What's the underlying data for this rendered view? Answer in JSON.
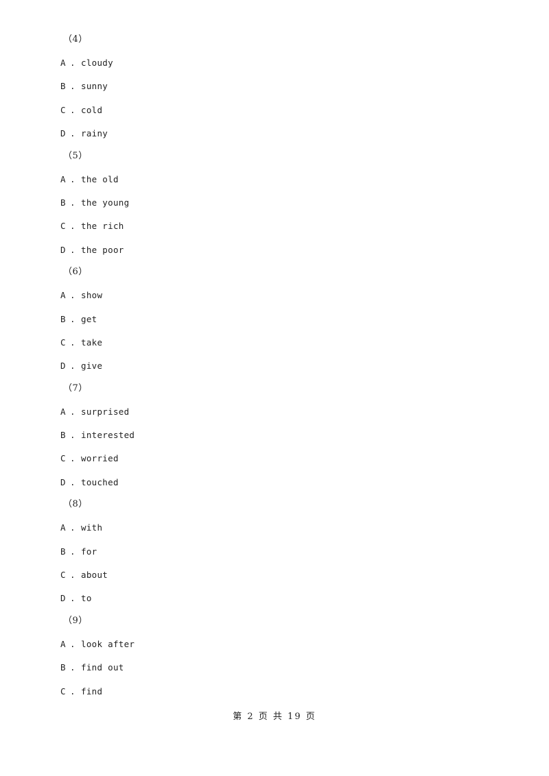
{
  "questions": [
    {
      "number": "（4）",
      "options": [
        {
          "letter": "A",
          "text": "cloudy"
        },
        {
          "letter": "B",
          "text": "sunny"
        },
        {
          "letter": "C",
          "text": "cold"
        },
        {
          "letter": "D",
          "text": "rainy"
        }
      ]
    },
    {
      "number": "（5）",
      "options": [
        {
          "letter": "A",
          "text": "the old"
        },
        {
          "letter": "B",
          "text": "the young"
        },
        {
          "letter": "C",
          "text": "the rich"
        },
        {
          "letter": "D",
          "text": "the poor"
        }
      ]
    },
    {
      "number": "（6）",
      "options": [
        {
          "letter": "A",
          "text": "show"
        },
        {
          "letter": "B",
          "text": "get"
        },
        {
          "letter": "C",
          "text": "take"
        },
        {
          "letter": "D",
          "text": "give"
        }
      ]
    },
    {
      "number": "（7）",
      "options": [
        {
          "letter": "A",
          "text": "surprised"
        },
        {
          "letter": "B",
          "text": "interested"
        },
        {
          "letter": "C",
          "text": "worried"
        },
        {
          "letter": "D",
          "text": "touched"
        }
      ]
    },
    {
      "number": "（8）",
      "options": [
        {
          "letter": "A",
          "text": "with"
        },
        {
          "letter": "B",
          "text": "for"
        },
        {
          "letter": "C",
          "text": "about"
        },
        {
          "letter": "D",
          "text": "to"
        }
      ]
    },
    {
      "number": "（9）",
      "options": [
        {
          "letter": "A",
          "text": "look after"
        },
        {
          "letter": "B",
          "text": "find out"
        },
        {
          "letter": "C",
          "text": "find"
        }
      ]
    }
  ],
  "separator": ".",
  "footer": {
    "text": "第 2 页 共 19 页"
  }
}
